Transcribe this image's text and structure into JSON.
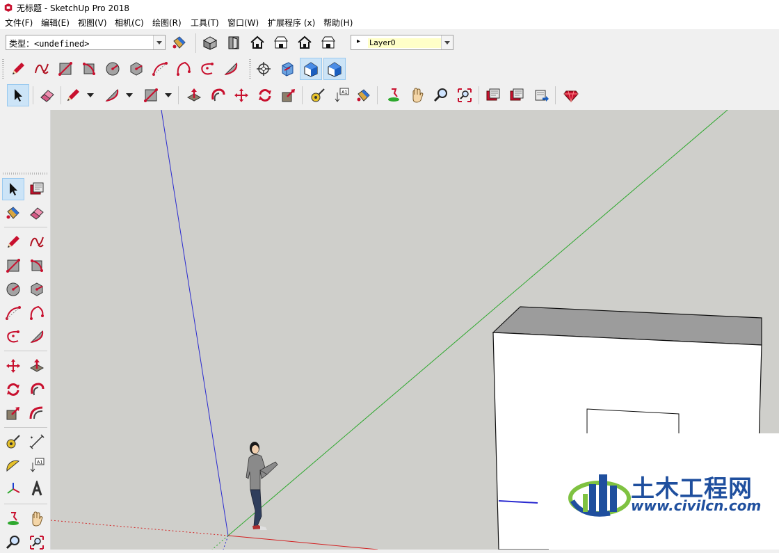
{
  "window": {
    "title": "无标题 - SketchUp Pro 2018"
  },
  "menu": [
    "文件(F)",
    "编辑(E)",
    "视图(V)",
    "相机(C)",
    "绘图(R)",
    "工具(T)",
    "窗口(W)",
    "扩展程序 (x)",
    "帮助(H)"
  ],
  "type_selector": {
    "value": "类型：<undefined>"
  },
  "layer_selector": {
    "value": "Layer0"
  },
  "colors": {
    "accent_red": "#c8102e",
    "blue_axis": "#2a2ad0",
    "green_axis": "#2ea82e",
    "red_axis": "#d22020",
    "viewport_bg": "#cfcfcb",
    "selected_tool": "#cce4f7"
  },
  "watermark": {
    "title": "土木工程网",
    "url": "www.civilcn.com"
  }
}
